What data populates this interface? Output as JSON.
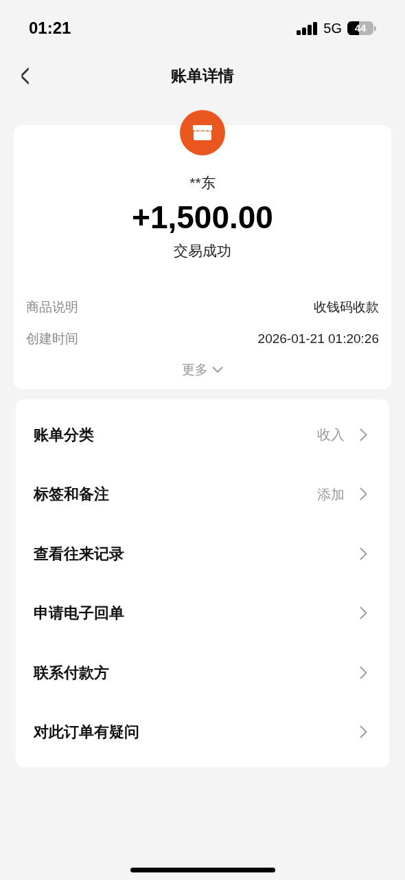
{
  "status_bar": {
    "time": "01:21",
    "network": "5G",
    "battery": "44"
  },
  "nav": {
    "back": "<",
    "title": "账单详情"
  },
  "summary": {
    "payer": "**东",
    "amount": "+1,500.00",
    "status": "交易成功",
    "details": [
      {
        "label": "商品说明",
        "value": "收钱码收款"
      },
      {
        "label": "创建时间",
        "value": "2026-01-21 01:20:26"
      }
    ],
    "more": "更多"
  },
  "menu": [
    {
      "label": "账单分类",
      "value": "收入"
    },
    {
      "label": "标签和备注",
      "value": "添加"
    },
    {
      "label": "查看往来记录"
    },
    {
      "label": "申请电子回单"
    },
    {
      "label": "联系付款方"
    },
    {
      "label": "对此订单有疑问"
    }
  ]
}
